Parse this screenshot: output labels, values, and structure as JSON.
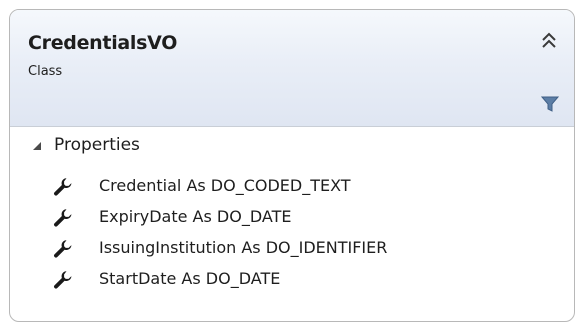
{
  "class_shape": {
    "name": "CredentialsVO",
    "kind": "Class",
    "sections": [
      {
        "label": "Properties",
        "expanded": true,
        "members": [
          {
            "label": "Credential As DO_CODED_TEXT",
            "icon": "wrench-icon"
          },
          {
            "label": "ExpiryDate As DO_DATE",
            "icon": "wrench-icon"
          },
          {
            "label": "IssuingInstitution As DO_IDENTIFIER",
            "icon": "wrench-icon"
          },
          {
            "label": "StartDate As DO_DATE",
            "icon": "wrench-icon"
          }
        ]
      }
    ]
  },
  "colors": {
    "border": "#b8b8b8",
    "header_gradient_top": "#f5f8fc",
    "header_gradient_bottom": "#dfe6f2",
    "text": "#1e1e1e",
    "icon": "#1a1a1a",
    "filter_icon": "#5c7ea6"
  }
}
